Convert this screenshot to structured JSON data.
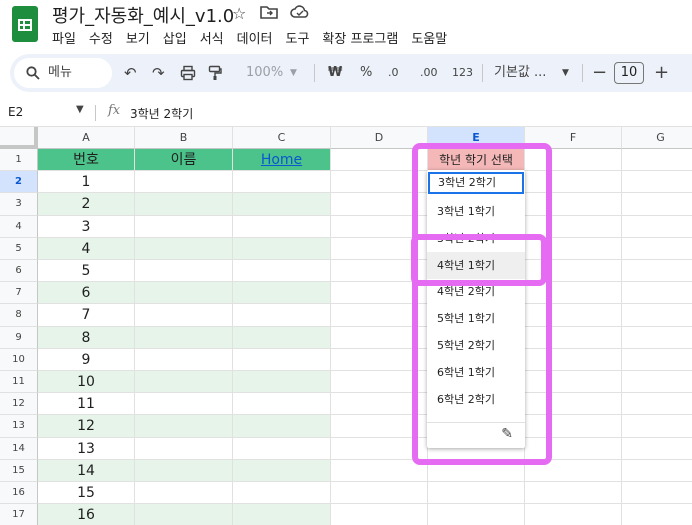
{
  "doc": {
    "title": "평가_자동화_예시_v1.0"
  },
  "menu": [
    "파일",
    "수정",
    "보기",
    "삽입",
    "서식",
    "데이터",
    "도구",
    "확장 프로그램",
    "도움말"
  ],
  "toolbar": {
    "search_label": "메뉴",
    "zoom": "100%",
    "currency": "₩",
    "percent": "%",
    "dec_decrease": ".0",
    "dec_increase": ".00",
    "number_format": "123",
    "font_name": "기본값 ...",
    "font_size": "10",
    "minus": "−",
    "plus": "+"
  },
  "formula_bar": {
    "cell_ref": "E2",
    "fx": "fx",
    "value": "3학년 2학기"
  },
  "columns": [
    "A",
    "B",
    "C",
    "D",
    "E",
    "F",
    "G"
  ],
  "rows": [
    "1",
    "2",
    "3",
    "4",
    "5",
    "6",
    "7",
    "8",
    "9",
    "10",
    "11",
    "12",
    "13",
    "14",
    "15",
    "16",
    "17"
  ],
  "header_row": {
    "a": "번호",
    "b": "이름",
    "c": "Home",
    "e": "학년 학기 선택"
  },
  "numbers": [
    "1",
    "2",
    "3",
    "4",
    "5",
    "6",
    "7",
    "8",
    "9",
    "10",
    "11",
    "12",
    "13",
    "14",
    "15",
    "16"
  ],
  "dropdown": {
    "selected": "3학년 2학기",
    "options": [
      "3학년 1학기",
      "3학년 2학기",
      "4학년 1학기",
      "4학년 2학기",
      "5학년 1학기",
      "5학년 2학기",
      "6학년 1학기",
      "6학년 2학기"
    ],
    "hovered_index": 2
  },
  "colors": {
    "header_green": "#4bc38a",
    "band_green": "#e6f4ea",
    "e1_pink": "#f4b8b8",
    "highlight": "#e56cf2",
    "selection_blue": "#1a73e8"
  }
}
